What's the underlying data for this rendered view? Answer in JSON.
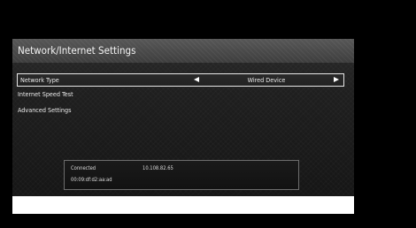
{
  "panel": {
    "title": "Network/Internet Settings"
  },
  "menu": {
    "items": [
      {
        "label": "Network Type",
        "value": "Wired Device",
        "selected": true
      },
      {
        "label": "Internet Speed Test"
      },
      {
        "label": "Advanced Settings"
      }
    ]
  },
  "status": {
    "connection": "Connected",
    "ip_address": "10.108.82.65",
    "mac_address": "00:09:df:d2:aa:ad"
  },
  "icons": {
    "left": "triangle-left-icon",
    "right": "triangle-right-icon"
  },
  "colors": {
    "background": "#000000",
    "title_bar": "#4a4a4a",
    "text": "#ececec",
    "selection_border": "#e6e6e6"
  }
}
